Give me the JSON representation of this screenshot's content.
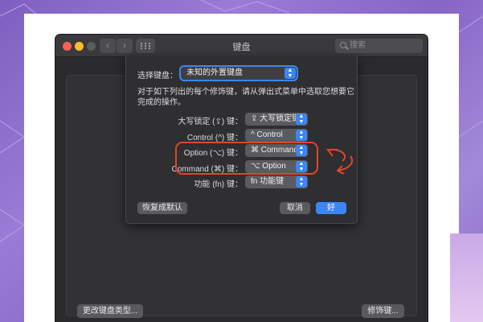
{
  "window": {
    "title": "键盘",
    "search_placeholder": "搜索",
    "change_keyboard_type_label": "更改键盘类型...",
    "modifier_keys_label": "修饰键..."
  },
  "sheet": {
    "select_keyboard_label": "选择键盘：",
    "keyboard_value": "未知的外置键盘",
    "description": "对于如下列出的每个修饰键，请从弹出式菜单中选取您想要它完成的操作。",
    "rows": [
      {
        "key_label": "大写锁定 (⇪) 键：",
        "action": "⇪ 大写锁定键"
      },
      {
        "key_label": "Control (^) 键：",
        "action": "^ Control"
      },
      {
        "key_label": "Option (⌥) 键：",
        "action": "⌘ Command"
      },
      {
        "key_label": "Command (⌘) 键：",
        "action": "⌥ Option"
      },
      {
        "key_label": "功能 (fn) 键：",
        "action": "fn 功能键"
      }
    ],
    "restore_defaults_label": "恢复成默认",
    "cancel_label": "取消",
    "ok_label": "好"
  },
  "colors": {
    "accent": "#3b86f7",
    "annotation": "#e0462d"
  },
  "icons": [
    "chevron-left-icon",
    "chevron-right-icon",
    "grid-icon",
    "search-icon",
    "popup-chevrons-icon",
    "swap-arrows-icon"
  ]
}
